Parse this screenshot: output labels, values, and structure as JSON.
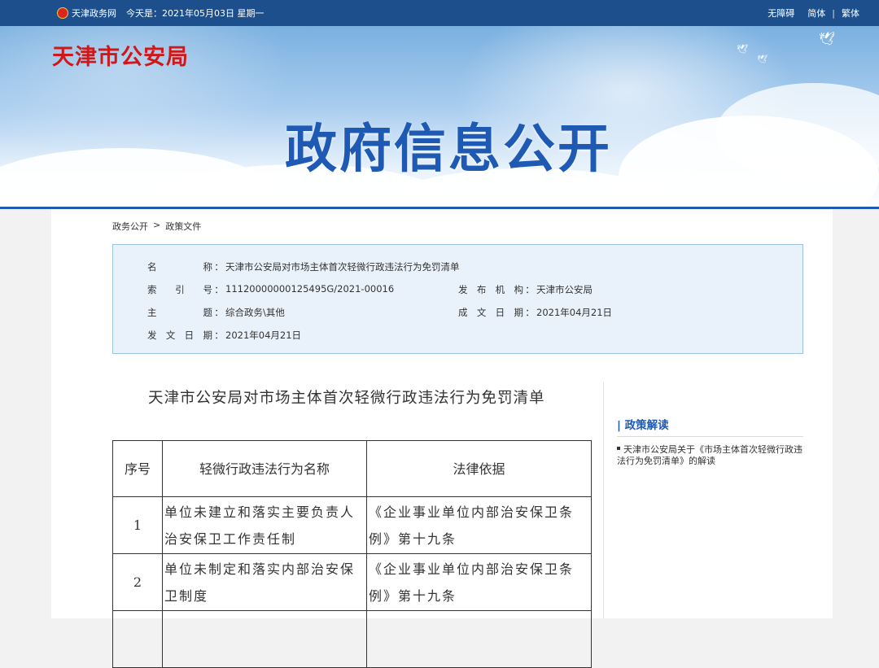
{
  "topbar": {
    "site_name": "天津政务网",
    "date_text": "今天是：2021年05月03日 星期一",
    "accessibility": "无障碍",
    "simplified": "简体",
    "separator": "|",
    "traditional": "繁体"
  },
  "banner": {
    "agency": "天津市公安局",
    "title": "政府信息公开"
  },
  "breadcrumb": {
    "items": [
      "政务公开",
      "政策文件"
    ],
    "separator": ">"
  },
  "info": {
    "name_label": "名称",
    "name_value": "天津市公安局对市场主体首次轻微行政违法行为免罚清单",
    "index_label": "索引号",
    "index_value": "11120000000125495G/2021-00016",
    "issuer_label": "发布机构",
    "issuer_value": "天津市公安局",
    "subject_label": "主题",
    "subject_value": "综合政务\\其他",
    "created_label": "成文日期",
    "created_value": "2021年04月21日",
    "published_label": "发文日期",
    "published_value": "2021年04月21日",
    "colon": "："
  },
  "document": {
    "title": "天津市公安局对市场主体首次轻微行政违法行为免罚清单",
    "table": {
      "headers": [
        "序号",
        "轻微行政违法行为名称",
        "法律依据"
      ],
      "rows": [
        {
          "no": "1",
          "name_line1": "单位未建立和落实主要负责人",
          "name_line2": "治安保卫工作责任制",
          "basis_line1": "《企业事业单位内部治安保卫条",
          "basis_line2": "例》第十九条"
        },
        {
          "no": "2",
          "name_line1": "单位未制定和落实内部治安保",
          "name_line2": "卫制度",
          "basis_line1": "《企业事业单位内部治安保卫条",
          "basis_line2": "例》第十九条"
        }
      ]
    }
  },
  "sidebar": {
    "title": "| 政策解读",
    "item": "天津市公安局关于《市场主体首次轻微行政违法行为免罚清单》的解读"
  }
}
